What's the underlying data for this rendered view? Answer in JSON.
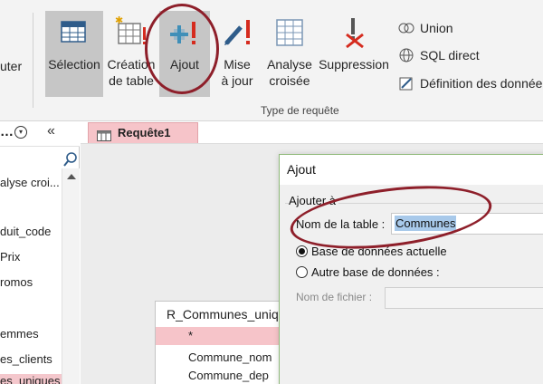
{
  "ribbon": {
    "cut_label": "uter",
    "buttons": {
      "selection": "Sélection",
      "creation_l1": "Création",
      "creation_l2": "de table",
      "ajout": "Ajout",
      "mise_l1": "Mise",
      "mise_l2": "à jour",
      "analyse_l1": "Analyse",
      "analyse_l2": "croisée",
      "suppression": "Suppression"
    },
    "small": {
      "union": "Union",
      "sql": "SQL direct",
      "definition": "Définition des donnée"
    },
    "group_label": "Type de requête"
  },
  "nav": {
    "dots": "…",
    "dropdown_glyph": "▾",
    "collapse_glyph": "«",
    "items": [
      "alyse croi...",
      "duit_code",
      "Prix",
      "romos",
      "emmes",
      "es_clients",
      "es_uniques"
    ]
  },
  "main": {
    "tab_label": "Requête1",
    "table_box": {
      "title": "R_Communes_uniqu",
      "star": "*",
      "fields": [
        "Commune_nom",
        "Commune_dep"
      ]
    }
  },
  "dialog": {
    "title": "Ajout",
    "group_label": "Ajouter à",
    "name_label": "Nom de la table :",
    "name_value": "Communes",
    "radio_current": "Base de données actuelle",
    "radio_other": "Autre base de données :",
    "file_label": "Nom de fichier :",
    "file_value": ""
  },
  "colors": {
    "annotation": "#8e1f2a",
    "tab_bg": "#f6c4c9",
    "selected_button_bg": "#c6c6c6",
    "selection_highlight": "#a8c9ea"
  }
}
